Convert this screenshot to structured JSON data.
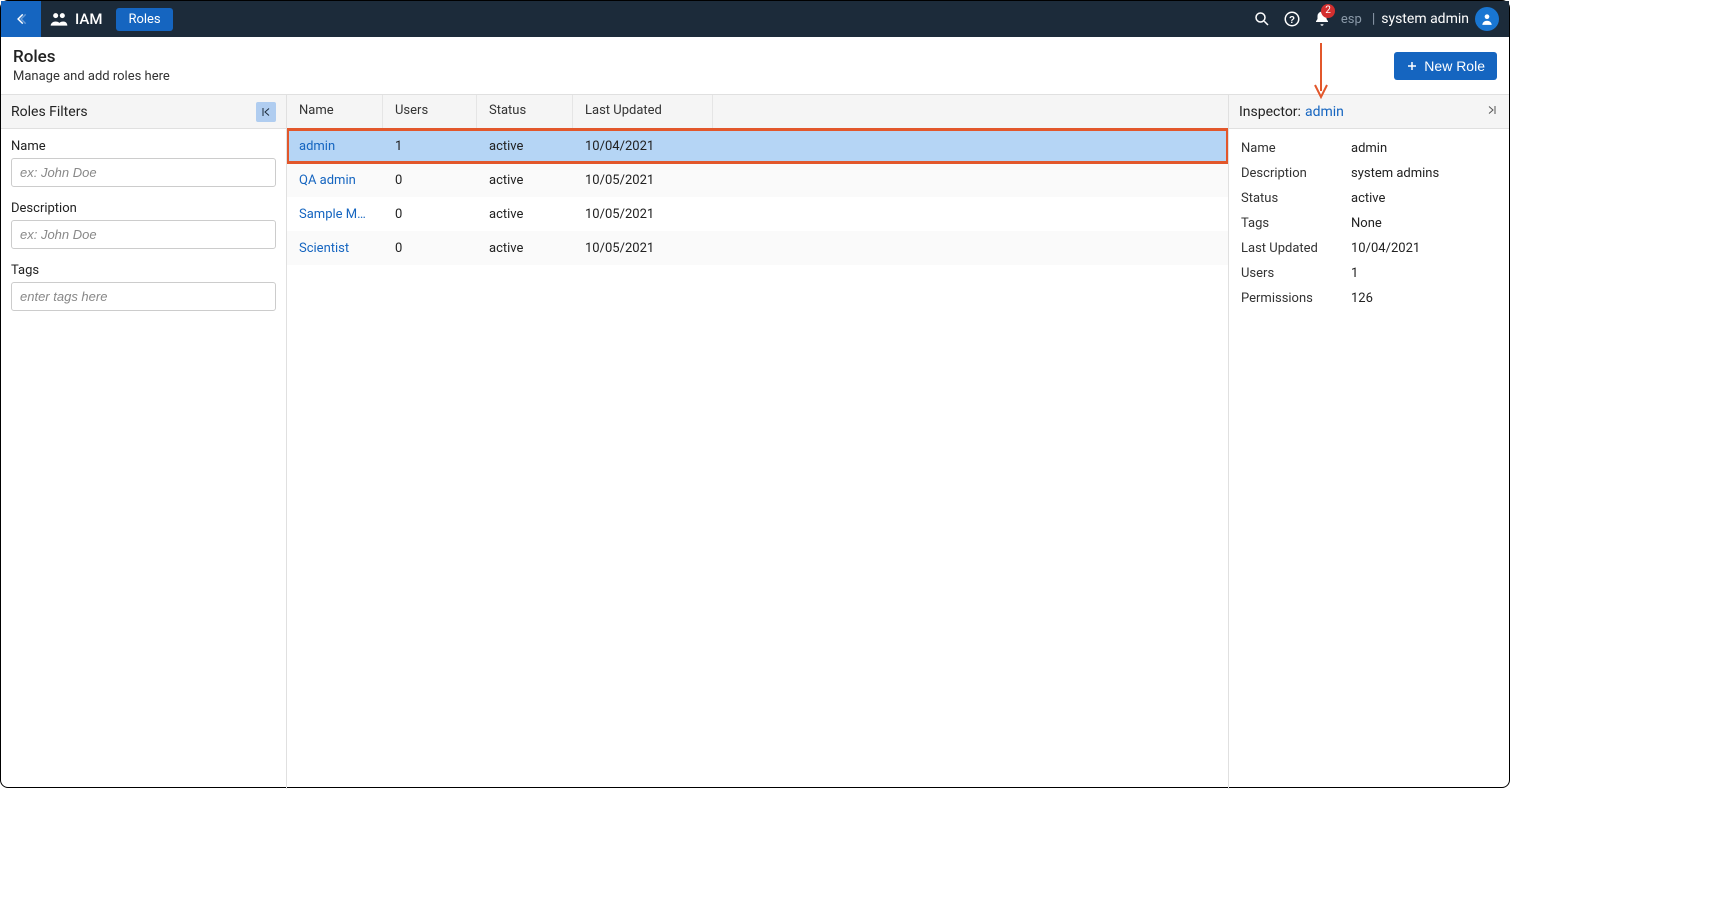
{
  "topbar": {
    "app_label": "IAM",
    "active_tab": "Roles",
    "notif_count": "2",
    "lang": "esp",
    "username": "system admin"
  },
  "page": {
    "title": "Roles",
    "subtitle": "Manage and add roles here",
    "new_role_btn": "New Role"
  },
  "filters": {
    "title": "Roles Filters",
    "name_label": "Name",
    "name_placeholder": "ex: John Doe",
    "desc_label": "Description",
    "desc_placeholder": "ex: John Doe",
    "tags_label": "Tags",
    "tags_placeholder": "enter tags here"
  },
  "table": {
    "headers": {
      "name": "Name",
      "users": "Users",
      "status": "Status",
      "last": "Last Updated"
    },
    "rows": [
      {
        "name": "admin",
        "users": "1",
        "status": "active",
        "last": "10/04/2021",
        "selected": true
      },
      {
        "name": "QA admin",
        "users": "0",
        "status": "active",
        "last": "10/05/2021",
        "selected": false
      },
      {
        "name": "Sample Manager",
        "users": "0",
        "status": "active",
        "last": "10/05/2021",
        "selected": false
      },
      {
        "name": "Scientist",
        "users": "0",
        "status": "active",
        "last": "10/05/2021",
        "selected": false
      }
    ]
  },
  "inspector": {
    "header_label": "Inspector:",
    "header_value": "admin",
    "fields": {
      "Name": "admin",
      "Description": "system admins",
      "Status": "active",
      "Tags": "None",
      "Last Updated": "10/04/2021",
      "Users": "1",
      "Permissions": "126"
    }
  }
}
